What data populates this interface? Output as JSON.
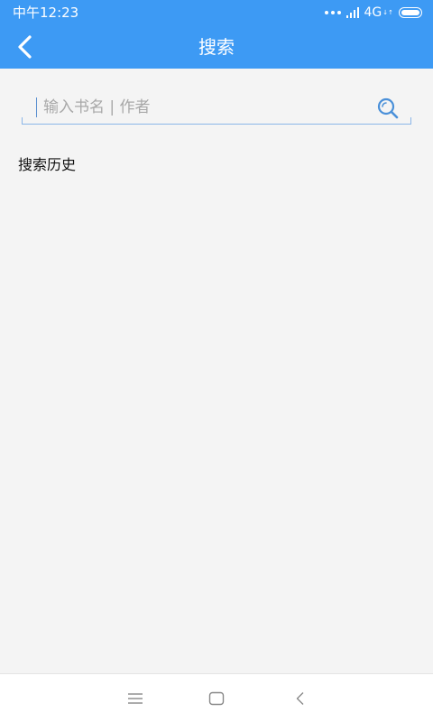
{
  "status_bar": {
    "time": "中午12:23",
    "network": "4G",
    "network_arrows": "↓↑"
  },
  "app_bar": {
    "title": "搜索",
    "back_icon": "chevron-left-icon",
    "background_color": "#3d9af4"
  },
  "search": {
    "placeholder": "输入书名 | 作者",
    "value": "",
    "icon": "search-icon",
    "accent_color": "#4a90d9"
  },
  "history": {
    "title": "搜索历史",
    "items": []
  },
  "nav_bar": {
    "menu_icon": "menu-icon",
    "home_icon": "home-icon",
    "back_icon": "back-icon"
  }
}
